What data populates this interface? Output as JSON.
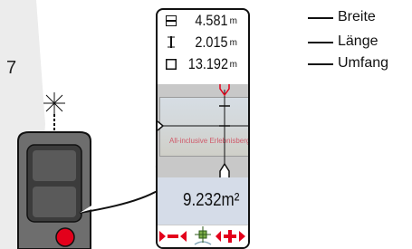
{
  "step": {
    "number": "7"
  },
  "measurements": [
    {
      "icon": "width-icon",
      "value": "4.581",
      "unit": "m",
      "label": "Breite"
    },
    {
      "icon": "length-icon",
      "value": "2.015",
      "unit": "m",
      "label": "Länge"
    },
    {
      "icon": "perimeter-icon",
      "value": "13.192",
      "unit": "m",
      "label": "Umfang"
    }
  ],
  "camera": {
    "overlay_text": "All-inclusive Erlebnisberg Pradaschier"
  },
  "result": {
    "value": "9.232m²"
  },
  "colors": {
    "accent": "#e3001b",
    "result_bg": "#d5dce8"
  }
}
